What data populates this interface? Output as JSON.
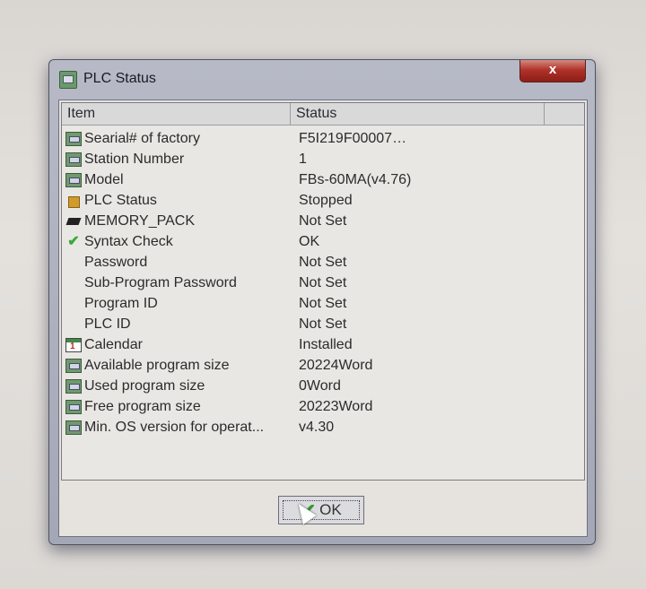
{
  "window": {
    "title": "PLC Status",
    "close_label": "x"
  },
  "list": {
    "columns": [
      "Item",
      "Status"
    ],
    "rows": [
      {
        "icon": "plc-icon",
        "item": "Searial# of factory",
        "status": "F5I219F00007…"
      },
      {
        "icon": "plc-icon",
        "item": "Station Number",
        "status": "1"
      },
      {
        "icon": "plc-icon",
        "item": "Model",
        "status": "FBs-60MA(v4.76)"
      },
      {
        "icon": "status-square-icon",
        "item": "PLC Status",
        "status": "Stopped"
      },
      {
        "icon": "memory-chip-icon",
        "item": "MEMORY_PACK",
        "status": "Not Set"
      },
      {
        "icon": "checkmark-icon",
        "item": "Syntax Check",
        "status": "OK"
      },
      {
        "icon": "none",
        "item": "Password",
        "status": "Not Set"
      },
      {
        "icon": "none",
        "item": "Sub-Program Password",
        "status": "Not Set"
      },
      {
        "icon": "none",
        "item": "Program ID",
        "status": "Not Set"
      },
      {
        "icon": "none",
        "item": "PLC ID",
        "status": "Not Set"
      },
      {
        "icon": "calendar-icon",
        "item": "Calendar",
        "status": "Installed"
      },
      {
        "icon": "plc-icon",
        "item": "Available program size",
        "status": "20224Word"
      },
      {
        "icon": "plc-icon",
        "item": "Used program size",
        "status": "0Word"
      },
      {
        "icon": "plc-icon",
        "item": "Free program size",
        "status": "20223Word"
      },
      {
        "icon": "plc-icon",
        "item": "Min. OS version for operat...",
        "status": "v4.30"
      }
    ]
  },
  "buttons": {
    "ok_label": "OK"
  },
  "colors": {
    "close_button": "#b0332a",
    "check_green": "#3aa83a",
    "status_orange": "#d09a2c"
  }
}
